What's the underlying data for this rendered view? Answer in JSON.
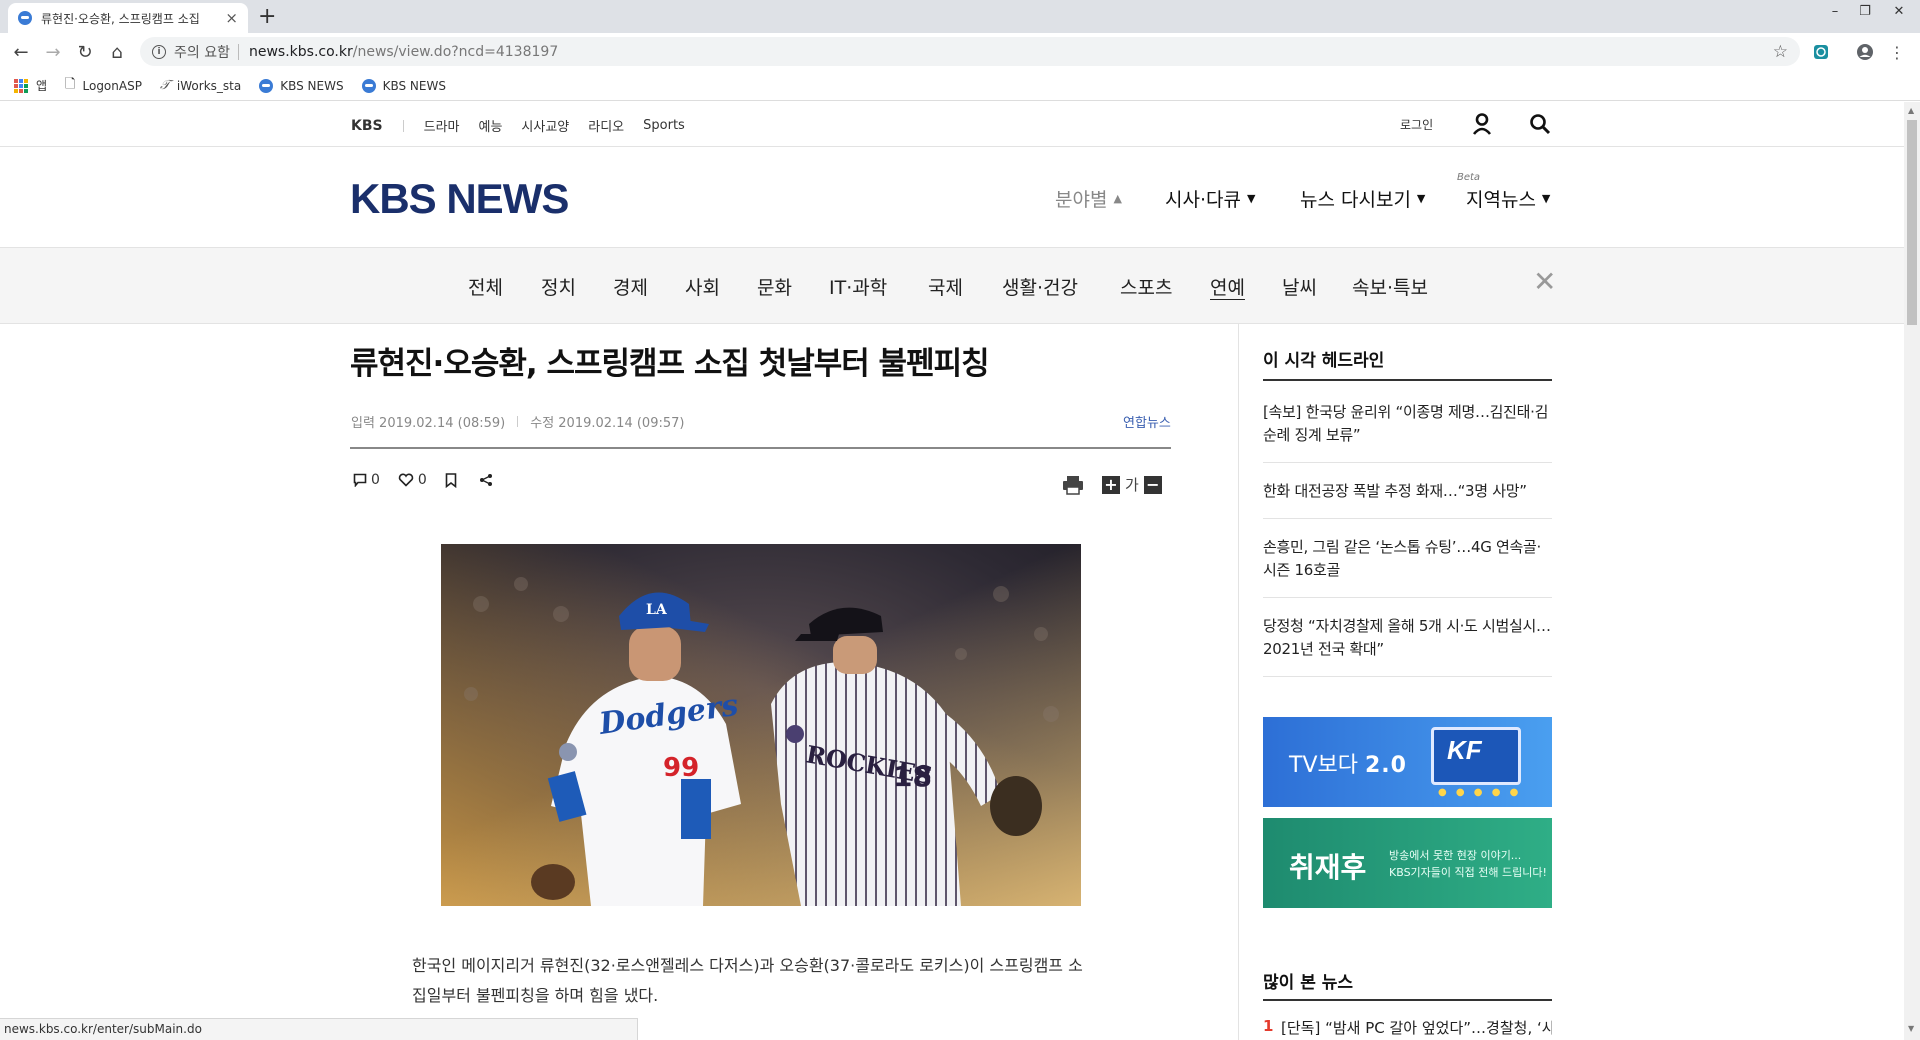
{
  "browser": {
    "tab_title": "류현진·오승환, 스프링캠프 소집",
    "new_tab": "+",
    "url_warning": "주의 요함",
    "url_host": "news.kbs.co.kr",
    "url_path": "/news/view.do?ncd=4138197",
    "bookmarks": [
      {
        "label": "앱",
        "icon": "apps-icon"
      },
      {
        "label": "LogonASP",
        "icon": "page-icon"
      },
      {
        "label": "iWorks_sta",
        "icon": "iworks-icon"
      },
      {
        "label": "KBS NEWS",
        "icon": "globe-icon"
      },
      {
        "label": "KBS NEWS",
        "icon": "globe-icon"
      }
    ],
    "status_url": "news.kbs.co.kr/enter/subMain.do"
  },
  "topbar": {
    "brand": "KBS",
    "links": [
      "드라마",
      "예능",
      "시사교양",
      "라디오",
      "Sports"
    ],
    "login": "로그인"
  },
  "header": {
    "logo": "KBS NEWS",
    "nav": [
      {
        "label": "분야별",
        "caret": "▲"
      },
      {
        "label": "시사·다큐",
        "caret": "▼"
      },
      {
        "label": "뉴스 다시보기",
        "caret": "▼"
      },
      {
        "label": "지역뉴스",
        "caret": "▼"
      }
    ],
    "beta": "Beta"
  },
  "categories": {
    "items": [
      "전체",
      "정치",
      "경제",
      "사회",
      "문화",
      "IT·과학",
      "국제",
      "생활·건강",
      "스포츠",
      "연예",
      "날씨",
      "속보·특보"
    ],
    "active": "연예",
    "close": "✕"
  },
  "article": {
    "headline": "류현진·오승환, 스프링캠프 소집 첫날부터 불펜피칭",
    "input_time": "입력 2019.02.14 (08:59)",
    "edit_time": "수정 2019.02.14 (09:57)",
    "source": "연합뉴스",
    "comments": "0",
    "likes": "0",
    "font_label": "가",
    "plus": "+",
    "minus": "−",
    "photo_jersey_left": "Dodgers",
    "photo_number_left": "99",
    "photo_jersey_right": "ROCKIES",
    "photo_number_right": "18",
    "body": "한국인 메이지리거 류현진(32·로스앤젤레스 다저스)과 오승환(37·콜로라도 로키스)이 스프링캠프 소집일부터 불펜피칭을 하며 힘을 냈다."
  },
  "sidebar": {
    "headline_title": "이 시각 헤드라인",
    "headlines": [
      "[속보] 한국당 윤리위 “이종명 제명…김진태·김순례 징계 보류”",
      "한화 대전공장 폭발 추정 화재…“3명 사망”",
      "손흥민, 그림 같은 ‘논스톱 슈팅’…4G 연속골·시즌 16호골",
      "당정청 “자치경찰제 올해 5개 시·도 시범실시…2021년 전국 확대”"
    ],
    "banner1_prefix": "TV보다",
    "banner1_bold": "2.0",
    "banner1_logo": "KF",
    "banner2_title": "취재후",
    "banner2_sub1": "방송에서 못한 현장 이야기...",
    "banner2_sub2": "KBS기자들이 직접 전해 드립니다!",
    "popular_title": "많이 본 뉴스",
    "popular": [
      {
        "rank": "1",
        "title": "[단독] “밤새 PC 갈아 엎었다”…경찰청, ‘사찰"
      }
    ]
  }
}
